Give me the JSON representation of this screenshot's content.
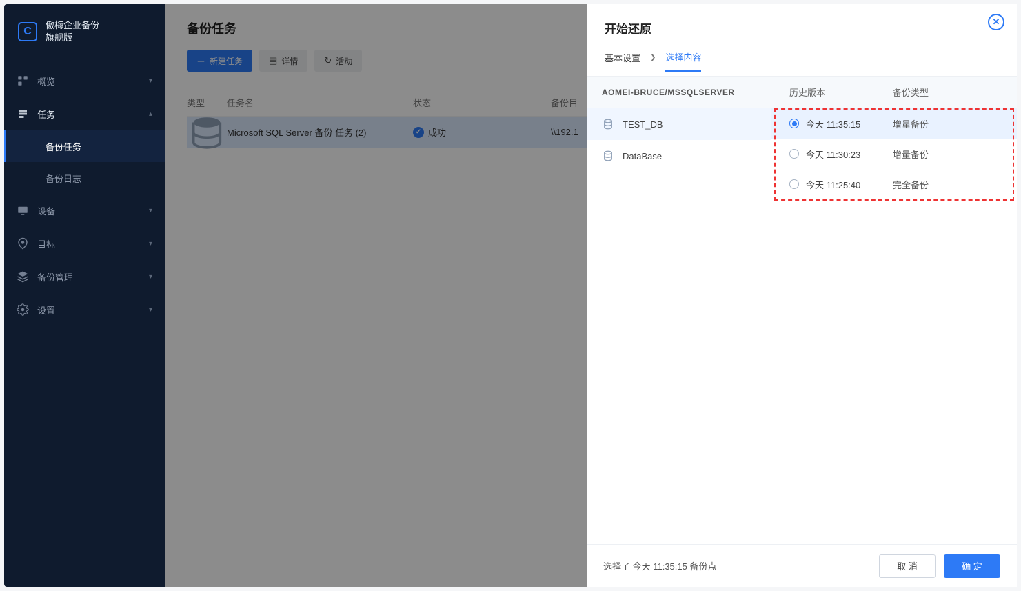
{
  "brand": {
    "line1": "傲梅企业备份",
    "line2": "旗舰版"
  },
  "sidebar": {
    "items": [
      {
        "label": "概览"
      },
      {
        "label": "任务"
      },
      {
        "label": "设备"
      },
      {
        "label": "目标"
      },
      {
        "label": "备份管理"
      },
      {
        "label": "设置"
      }
    ],
    "subtasks": [
      {
        "label": "备份任务"
      },
      {
        "label": "备份日志"
      }
    ]
  },
  "page": {
    "title": "备份任务",
    "new_task": "新建任务",
    "details": "详情",
    "activity": "活动"
  },
  "table": {
    "headers": {
      "type": "类型",
      "name": "任务名",
      "status": "状态",
      "target": "备份目"
    },
    "rows": [
      {
        "name": "Microsoft SQL Server 备份 任务 (2)",
        "status": "成功",
        "target": "\\\\192.1"
      }
    ]
  },
  "panel": {
    "title": "开始还原",
    "steps": {
      "basic": "基本设置",
      "select": "选择内容"
    },
    "source": "AOMEI-BRUCE/MSSQLSERVER",
    "databases": [
      {
        "name": "TEST_DB"
      },
      {
        "name": "DataBase"
      }
    ],
    "ver_headers": {
      "version": "历史版本",
      "type": "备份类型"
    },
    "versions": [
      {
        "time": "今天 11:35:15",
        "type": "增量备份"
      },
      {
        "time": "今天 11:30:23",
        "type": "增量备份"
      },
      {
        "time": "今天 11:25:40",
        "type": "完全备份"
      }
    ],
    "footer_info": "选择了 今天 11:35:15 备份点",
    "cancel": "取 消",
    "confirm": "确 定"
  }
}
